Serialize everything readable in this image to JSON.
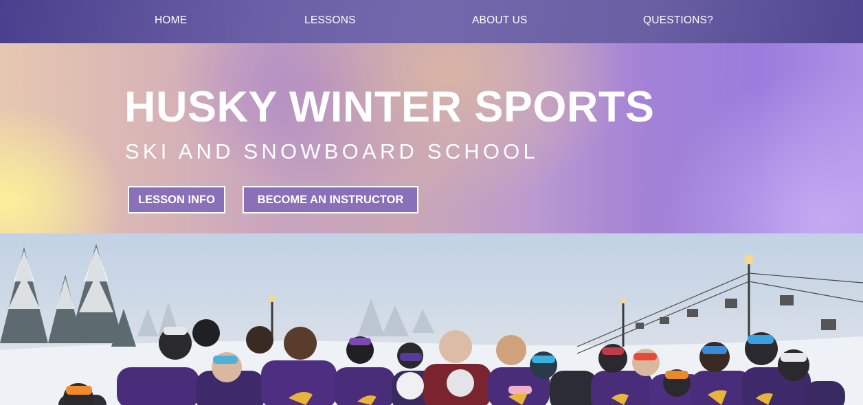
{
  "nav": {
    "items": [
      {
        "label": "HOME"
      },
      {
        "label": "LESSONS"
      },
      {
        "label": "ABOUT US"
      },
      {
        "label": "QUESTIONS?"
      }
    ]
  },
  "hero": {
    "title": "HUSKY WINTER SPORTS",
    "subtitle": "SKI AND SNOWBOARD SCHOOL",
    "buttons": {
      "lesson_info": "LESSON INFO",
      "become_instructor": "BECOME AN INSTRUCTOR"
    }
  },
  "photo": {
    "subject": "group-of-skiers-and-snowboarders-on-snowy-slope",
    "colors": {
      "jacket_purple": "#4a2d7a",
      "accent_gold": "#e8b43a"
    }
  }
}
